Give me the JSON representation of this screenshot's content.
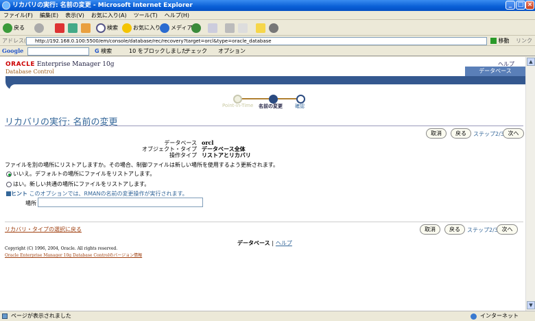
{
  "window": {
    "title": "リカバリの実行: 名前の変更 - Microsoft Internet Explorer",
    "btn_min": "_",
    "btn_max": "□",
    "btn_close": "×"
  },
  "menu": [
    "ファイル(F)",
    "編集(E)",
    "表示(V)",
    "お気に入り(A)",
    "ツール(T)",
    "ヘルプ(H)"
  ],
  "toolbar": {
    "back": "戻る",
    "search": "検索",
    "favorites": "お気に入り",
    "media": "メディア"
  },
  "address": {
    "label": "アドレス(D)",
    "url": "http://192.168.0.100:5500/em/console/database/rec/recovery?target=orcl&type=oracle_database",
    "go": "移動",
    "links": "リンク"
  },
  "google": {
    "logo": "Google",
    "search": "検索",
    "blocked": "10 をブロックしました",
    "check": "チェック",
    "options": "オプション"
  },
  "header": {
    "oracle": "ORACLE",
    "product": "Enterprise Manager 10g",
    "subtitle": "Database Control",
    "help": "ヘルプ",
    "tab": "データベース"
  },
  "train": {
    "steps": [
      "Point-in-Time",
      "名前の変更",
      "確認"
    ],
    "current_index": 1
  },
  "page": {
    "title": "リカバリの実行: 名前の変更",
    "cancel": "取消",
    "back": "戻る",
    "step": "ステップ2/3",
    "next": "次へ",
    "info": [
      {
        "label": "データベース",
        "value": "orcl"
      },
      {
        "label": "オブジェクト・タイプ",
        "value": "データベース全体"
      },
      {
        "label": "操作タイプ",
        "value": "リストアとリカバリ"
      }
    ],
    "question": "ファイルを別の場所にリストアしますか。その場合、制御ファイルは新しい場所を使用するよう更新されます。",
    "radio_no": "いいえ。デフォルトの場所にファイルをリストアします。",
    "radio_yes": "はい。新しい共通の場所にファイルをリストアします。",
    "hint_label": "ヒント",
    "hint_text": "このオプションでは、RMANの名前の変更操作が実行されます。",
    "location_label": "場所",
    "location_value": "",
    "back_link": "リカバリ・タイプの選択に戻る"
  },
  "footer": {
    "database": "データベース",
    "separator": "|",
    "help": "ヘルプ",
    "copyright": "Copyright (C) 1996, 2004, Oracle. All rights reserved.",
    "version": "Oracle Enterprise Manager 10g Database Controlのバージョン情報"
  },
  "status": {
    "text": "ページが表示されました",
    "zone": "インターネット"
  }
}
